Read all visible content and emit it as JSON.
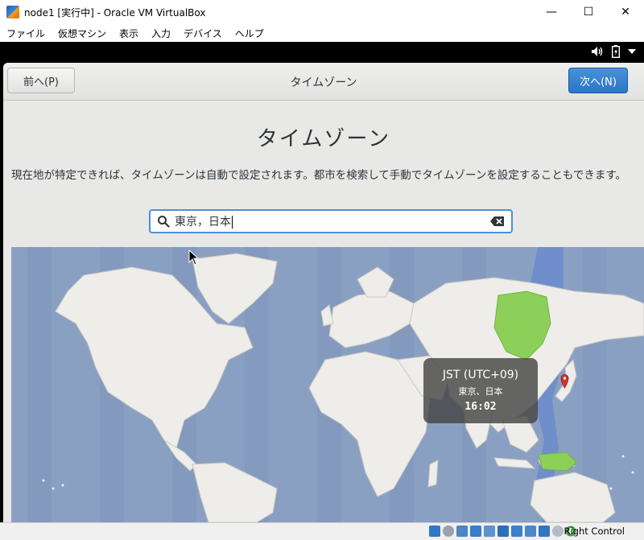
{
  "window": {
    "title": "node1 [実行中] - Oracle VM VirtualBox",
    "minimize_icon": "—",
    "maximize_icon": "☐",
    "close_icon": "✕"
  },
  "menu": [
    "ファイル",
    "仮想マシン",
    "表示",
    "入力",
    "デバイス",
    "ヘルプ"
  ],
  "installer": {
    "back_label": "前へ(P)",
    "header_title": "タイムゾーン",
    "next_label": "次へ(N)",
    "heading": "タイムゾーン",
    "description": "現在地が特定できれば、タイムゾーンは自動で設定されます。都市を検索して手動でタイムゾーンを設定することもできます。",
    "search_value": "東京，日本"
  },
  "tooltip": {
    "zone": "JST (UTC+09)",
    "city": "東京、日本",
    "time": "16:02"
  },
  "statusbar": {
    "host_key": "Right Control"
  },
  "colors": {
    "accent": "#4a90d9",
    "ocean": "#8aa0c3",
    "land": "#efedea",
    "selected_zone_band": "#6f8ecb",
    "selected_region": "#8cd05a",
    "pin": "#d23535"
  },
  "icons": {
    "search": "search-icon",
    "clear": "clear-text-icon",
    "volume": "volume-icon",
    "battery": "battery-icon",
    "menu": "dropdown-arrow-icon",
    "pin": "location-pin-icon"
  }
}
